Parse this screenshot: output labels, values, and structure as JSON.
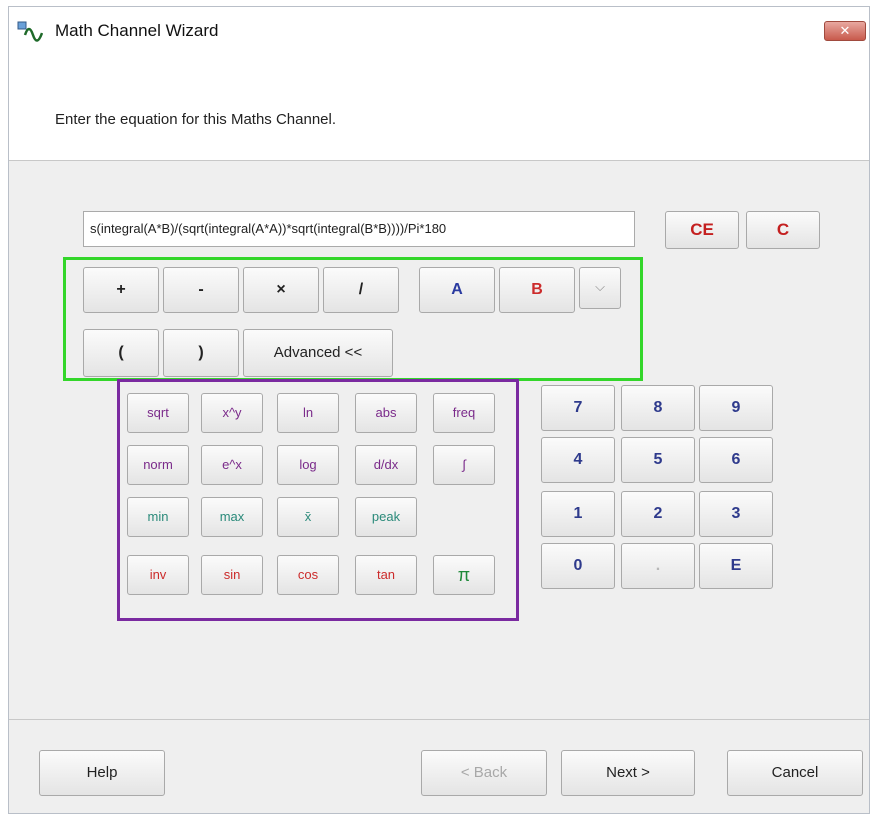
{
  "window": {
    "title": "Math Channel Wizard",
    "close_label": "✕"
  },
  "instruction": "Enter the equation for this Maths Channel.",
  "equation": {
    "value": "s(integral(A*B)/(sqrt(integral(A*A))*sqrt(integral(B*B))))/Pi*180"
  },
  "edit_buttons": {
    "ce": "CE",
    "c": "C"
  },
  "operators": {
    "plus": "+",
    "minus": "-",
    "multiply": "×",
    "divide": "/"
  },
  "channels": {
    "a": "A",
    "b": "B",
    "more": "⌵"
  },
  "parens": {
    "open": "(",
    "close": ")"
  },
  "advanced_label": "Advanced <<",
  "functions": {
    "sqrt": "sqrt",
    "x_pow_y": "x^y",
    "ln": "ln",
    "abs": "abs",
    "freq": "freq",
    "norm": "norm",
    "e_pow_x": "e^x",
    "log": "log",
    "ddx": "d/dx",
    "integral": "∫",
    "min": "min",
    "max": "max",
    "mean": "x̄",
    "peak": "peak",
    "inv": "inv",
    "sin": "sin",
    "cos": "cos",
    "tan": "tan",
    "pi": "π"
  },
  "keypad": {
    "k7": "7",
    "k8": "8",
    "k9": "9",
    "k4": "4",
    "k5": "5",
    "k6": "6",
    "k1": "1",
    "k2": "2",
    "k3": "3",
    "k0": "0",
    "kdot": ".",
    "ke": "E"
  },
  "footer": {
    "help": "Help",
    "back": "< Back",
    "next": "Next >",
    "cancel": "Cancel"
  },
  "colors": {
    "highlight_green": "#33d62a",
    "highlight_purple": "#7a2aa0",
    "accent_red": "#cc2b2b",
    "accent_blue": "#2a3aa0"
  }
}
